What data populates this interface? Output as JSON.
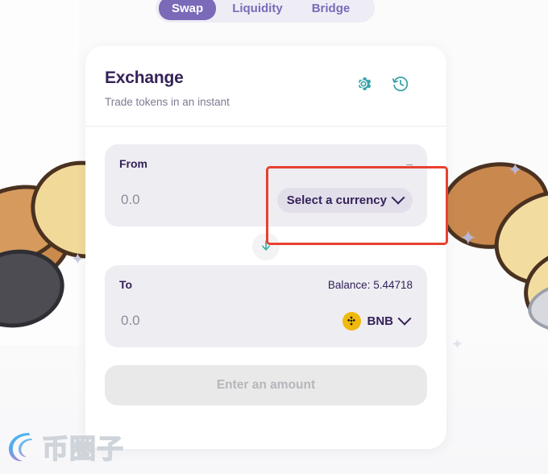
{
  "nav": {
    "tabs": [
      {
        "label": "Swap",
        "active": true
      },
      {
        "label": "Liquidity",
        "active": false
      },
      {
        "label": "Bridge",
        "active": false
      }
    ]
  },
  "card": {
    "title": "Exchange",
    "subtitle": "Trade tokens in an instant",
    "icons": {
      "settings": "gear-icon",
      "history": "history-clock-icon"
    }
  },
  "from_panel": {
    "label": "From",
    "right_note": "–",
    "amount_value": "0.0",
    "amount_placeholder": "0.0",
    "currency_button_label": "Select a currency",
    "has_token_icon": false
  },
  "swap_arrow": {
    "icon": "arrow-down-icon",
    "color": "#3aaf9f"
  },
  "to_panel": {
    "label": "To",
    "right_note": "Balance: 5.44718",
    "amount_value": "0.0",
    "amount_placeholder": "0.0",
    "currency_button_label": "BNB",
    "token_icon": "binance-bnb-icon",
    "token_icon_color": "#f0b90b"
  },
  "action": {
    "label": "Enter an amount",
    "enabled": false
  },
  "annotation": {
    "type": "red-rectangle-highlight",
    "target": "from-currency-selector",
    "color": "#e8412f"
  },
  "watermark": {
    "text": "币圈子",
    "logo": "circular-swoosh-logo"
  },
  "colors": {
    "brand_purple": "#7a6ab8",
    "title_navy": "#342258",
    "teal": "#35a3a8",
    "panel_bg": "#eeedf2",
    "card_bg": "#ffffff",
    "page_bg": "#fbfbfc",
    "binance_yellow": "#f0b90b",
    "annotation_red": "#e8412f"
  },
  "decorations": {
    "pancakes": 7,
    "sparkles": 4
  }
}
